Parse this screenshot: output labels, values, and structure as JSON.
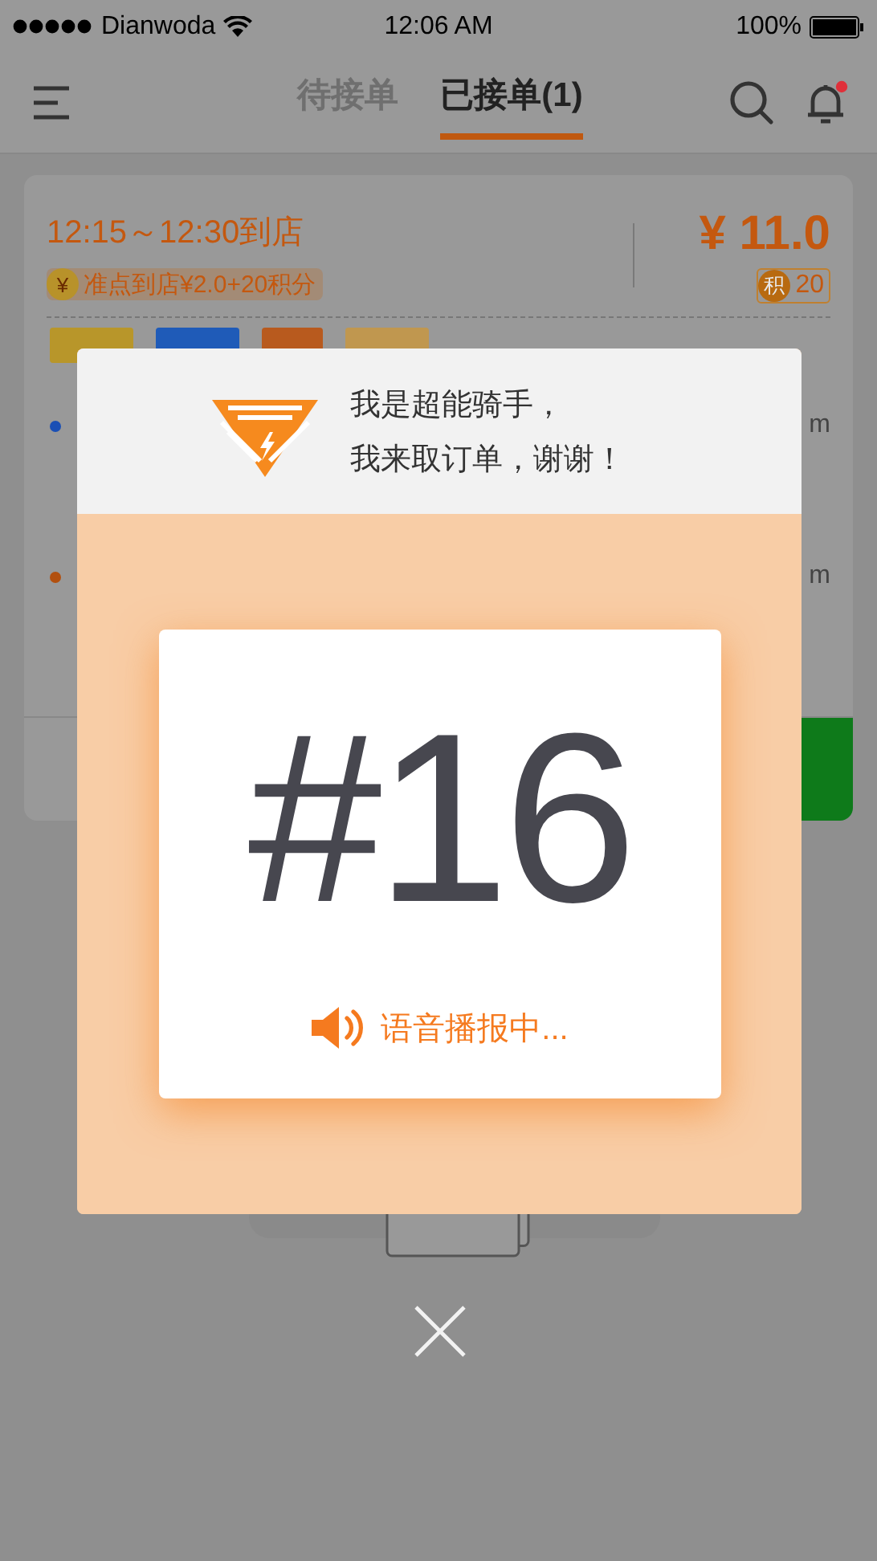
{
  "status_bar": {
    "carrier": "Dianwoda",
    "time": "12:06 AM",
    "battery": "100%"
  },
  "header": {
    "tabs": [
      {
        "label": "待接单",
        "selected": false
      },
      {
        "label": "已接单(1)",
        "selected": true
      }
    ],
    "notification_dot": true
  },
  "order_card": {
    "time_window": "12:15～12:30到店",
    "bonus_badge": "¥",
    "bonus": "准点到店¥2.0+20积分",
    "price": "¥ 11.0",
    "points_badge": "积",
    "points": "20",
    "tags": [
      {
        "color": "#b8962a"
      },
      {
        "color": "#1f5bb8"
      },
      {
        "color": "#b85a1e"
      },
      {
        "color": "#c0974f"
      }
    ],
    "stops": [
      {
        "color": "#1a4fb5",
        "distance": "m"
      },
      {
        "color": "#b2500f",
        "distance": "m"
      }
    ]
  },
  "dialog": {
    "message_lines": [
      "我是超能骑手，",
      "我来取订单，谢谢！"
    ],
    "number": "#16",
    "status": "语音播报中..."
  }
}
